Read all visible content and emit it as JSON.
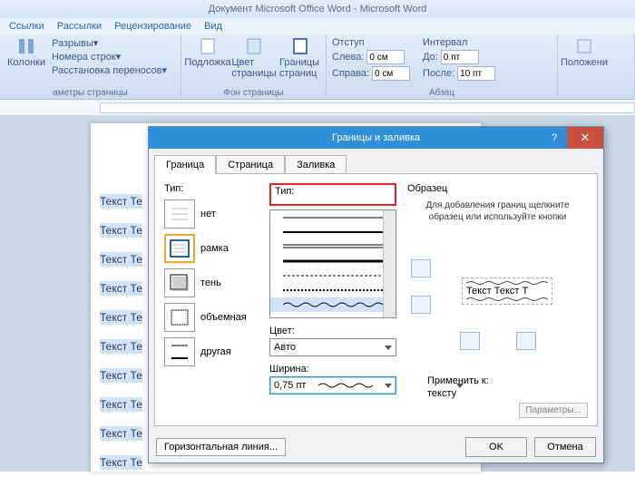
{
  "titlebar": "Документ Microsoft Office Word - Microsoft Word",
  "ribbon_tabs": {
    "t0": "Ссылки",
    "t1": "Рассылки",
    "t2": "Рецензирование",
    "t3": "Вид"
  },
  "ribbon": {
    "group_page": {
      "breaks": "Разрывы▾",
      "line_numbers": "Номера строк▾",
      "hyphenation": "Расстановка переносов▾",
      "columns": "Колонки",
      "label": "аметры страницы"
    },
    "group_bg": {
      "substrate": "Подложка",
      "color": "Цвет страницы",
      "borders": "Границы страниц",
      "label": "Фон страницы"
    },
    "group_para": {
      "indent": "Отступ",
      "left": "Слева:",
      "left_v": "0 см",
      "right": "Справа:",
      "right_v": "0 см",
      "interval": "Интервал",
      "before": "До:",
      "before_v": "0 пт",
      "after": "После:",
      "after_v": "10 пт",
      "label": "Абзац"
    },
    "arrange": "Положени"
  },
  "doc_line": "Текст Те",
  "dialog": {
    "title": "Границы и заливка",
    "tabs": {
      "t1": "Граница",
      "t2": "Страница",
      "t3": "Заливка"
    },
    "tip_label": "Тип:",
    "tip_items": {
      "none": "нет",
      "box": "рамка",
      "shadow": "тень",
      "threeD": "объемная",
      "custom": "другая"
    },
    "style_label": "Тип:",
    "color_label": "Цвет:",
    "color_value": "Авто",
    "width_label": "Ширина:",
    "width_value": "0,75 пт",
    "preview_label": "Образец",
    "preview_hint": "Для добавления границ щелкните образец или используйте кнопки",
    "preview_text": "Текст Текст Т",
    "apply_label": "Применить к:",
    "apply_value": "тексту",
    "params": "Параметры...",
    "hline": "Горизонтальная линия...",
    "ok": "OK",
    "cancel": "Отмена"
  }
}
